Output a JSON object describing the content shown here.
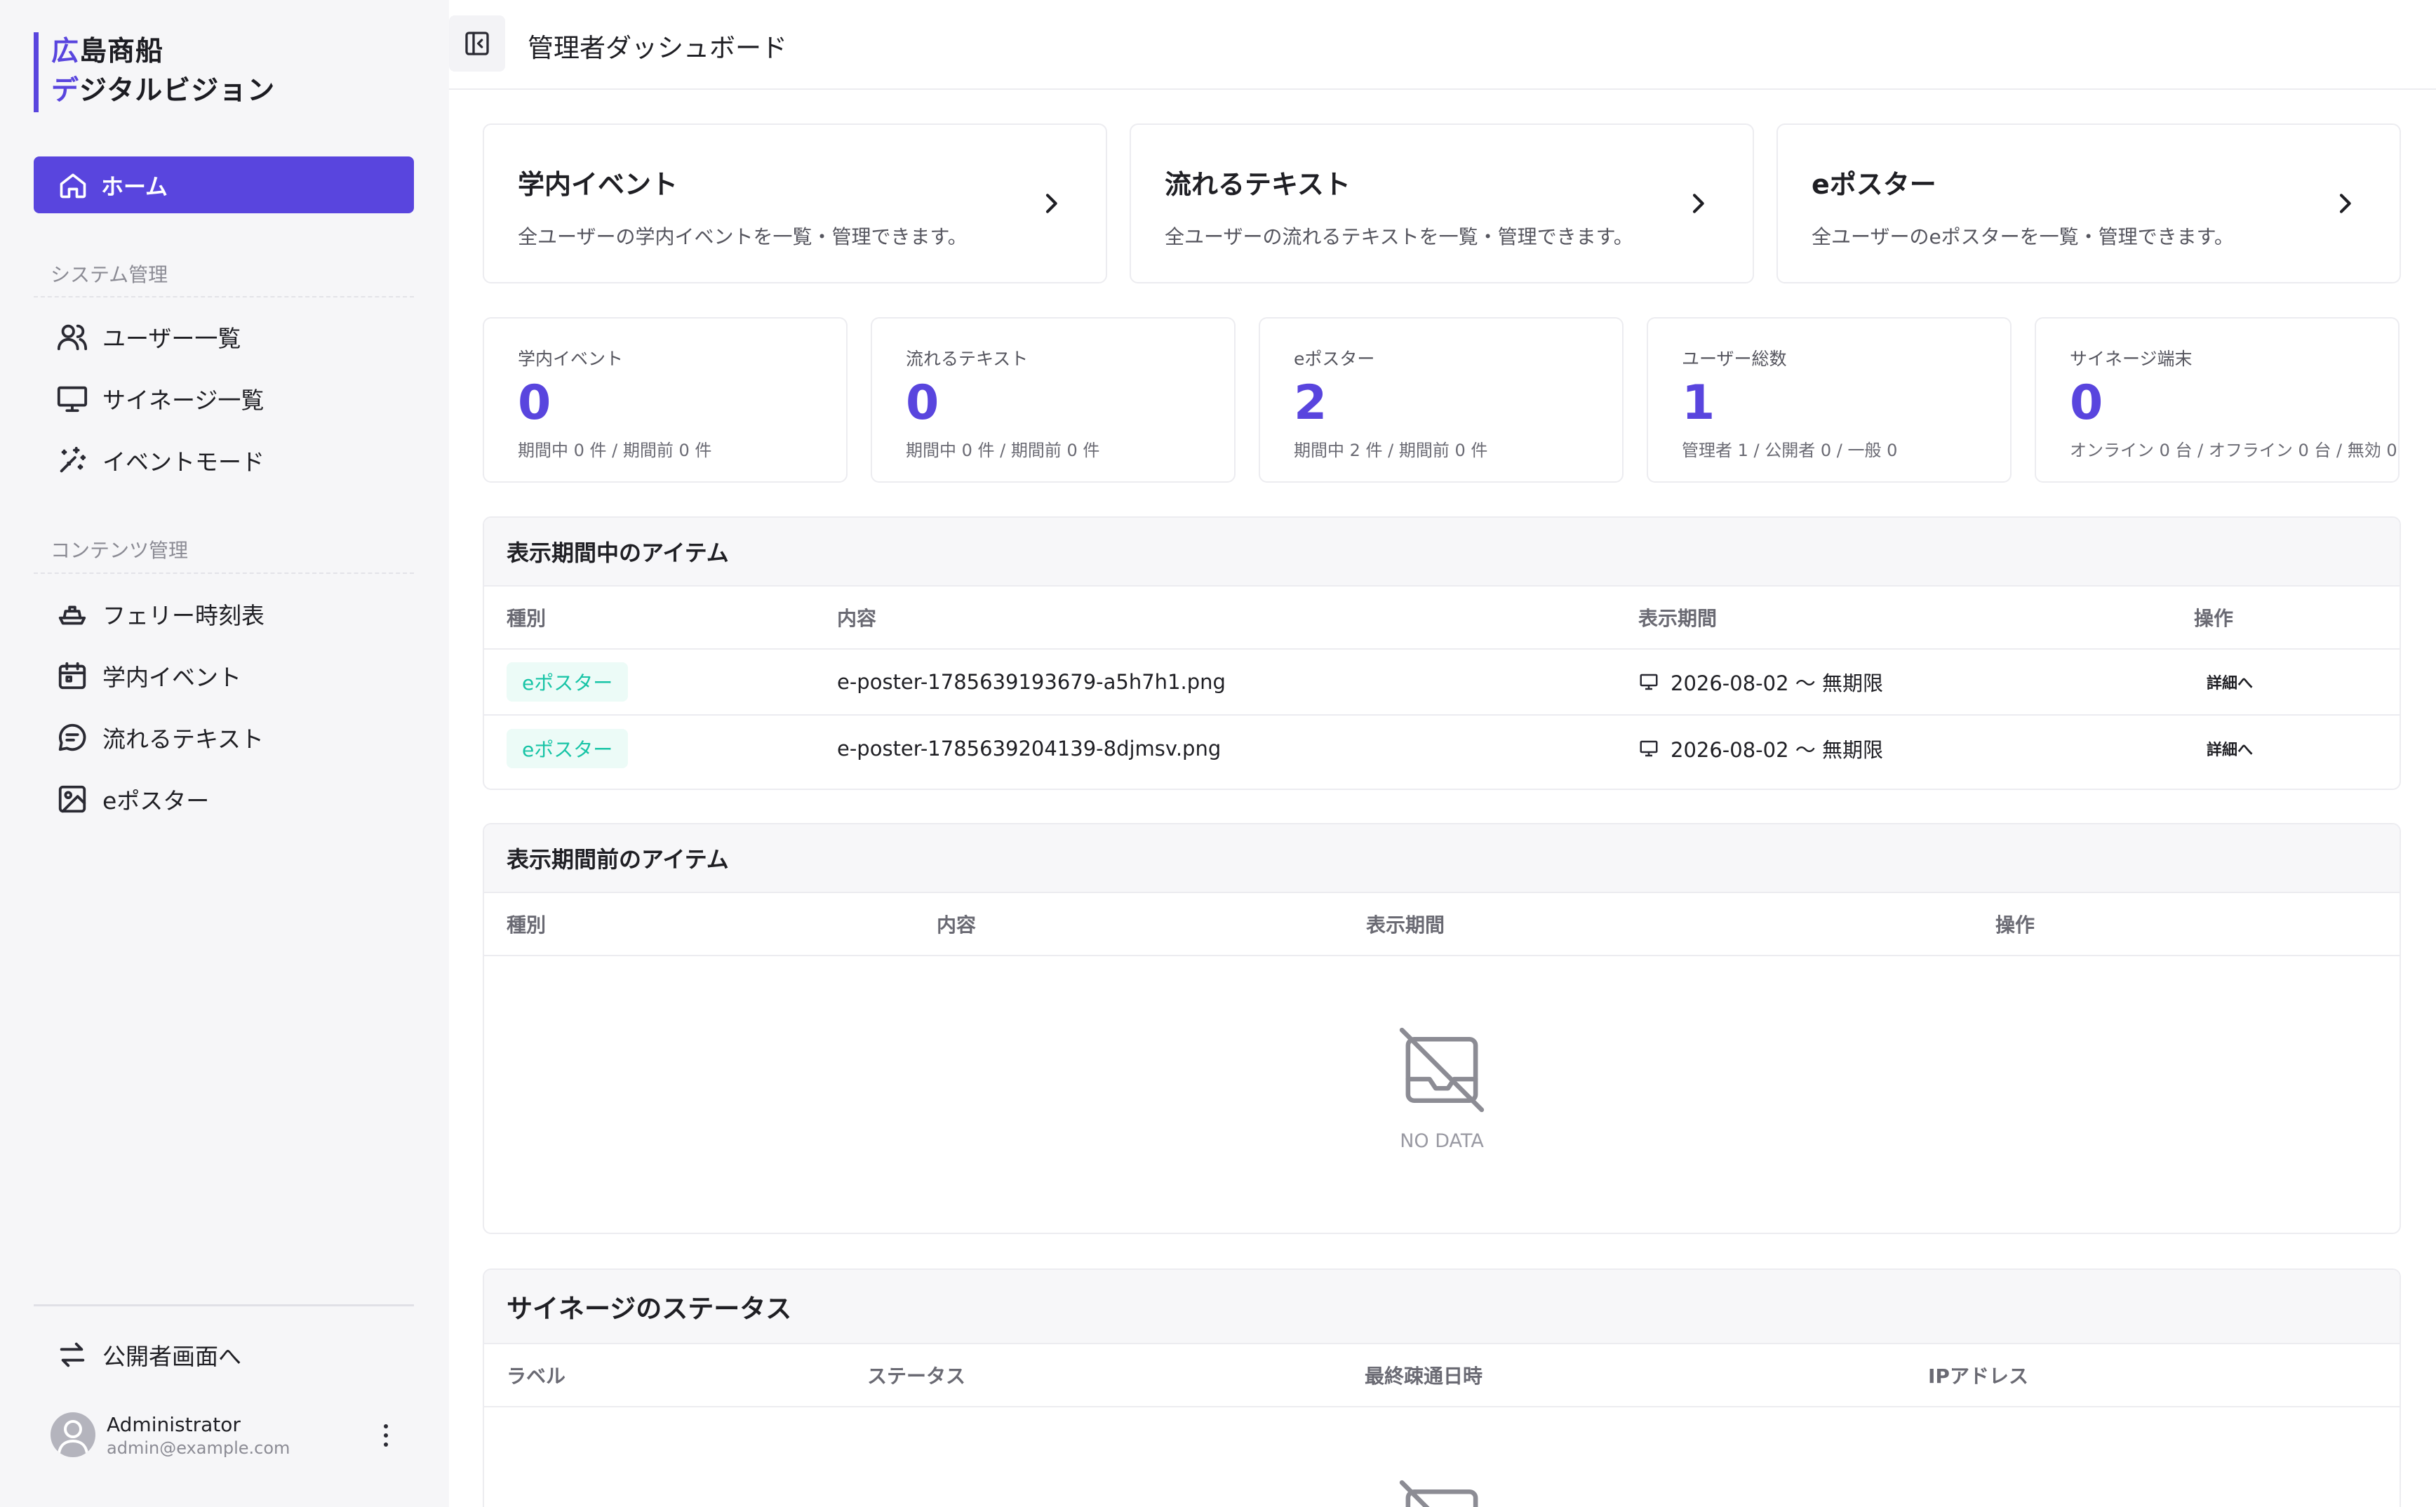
{
  "brand": {
    "line1_accent": "広",
    "line1_rest": "島商船",
    "line2_accent": "デ",
    "line2_rest": "ジタルビジョン"
  },
  "sidebar": {
    "home": "ホーム",
    "section_system": "システム管理",
    "system_items": [
      {
        "label": "ユーザー一覧",
        "icon": "users-icon"
      },
      {
        "label": "サイネージ一覧",
        "icon": "monitor-icon"
      },
      {
        "label": "イベントモード",
        "icon": "sparkles-icon"
      }
    ],
    "section_content": "コンテンツ管理",
    "content_items": [
      {
        "label": "フェリー時刻表",
        "icon": "ship-icon"
      },
      {
        "label": "学内イベント",
        "icon": "calendar-icon"
      },
      {
        "label": "流れるテキスト",
        "icon": "message-icon"
      },
      {
        "label": "eポスター",
        "icon": "image-icon"
      }
    ],
    "public_link": "公開者画面へ",
    "user": {
      "name": "Administrator",
      "email": "admin@example.com"
    }
  },
  "header": {
    "title": "管理者ダッシュボード"
  },
  "nav_cards": [
    {
      "title": "学内イベント",
      "desc": "全ユーザーの学内イベントを一覧・管理できます。"
    },
    {
      "title": "流れるテキスト",
      "desc": "全ユーザーの流れるテキストを一覧・管理できます。"
    },
    {
      "title": "eポスター",
      "desc": "全ユーザーのeポスターを一覧・管理できます。"
    }
  ],
  "stats": [
    {
      "label": "学内イベント",
      "value": "0",
      "sub": "期間中 0 件 / 期間前 0 件"
    },
    {
      "label": "流れるテキスト",
      "value": "0",
      "sub": "期間中 0 件 / 期間前 0 件"
    },
    {
      "label": "eポスター",
      "value": "2",
      "sub": "期間中 2 件 / 期間前 0 件"
    },
    {
      "label": "ユーザー総数",
      "value": "1",
      "sub": "管理者 1 / 公開者 0 / 一般 0"
    },
    {
      "label": "サイネージ端末",
      "value": "0",
      "sub": "オンライン 0 台 / オフライン 0 台 / 無効 0 台"
    }
  ],
  "active_panel": {
    "title": "表示期間中のアイテム",
    "columns": [
      "種別",
      "内容",
      "表示期間",
      "操作"
    ],
    "rows": [
      {
        "type": "eポスター",
        "content": "e-poster-1785639193679-a5h7h1.png",
        "period": "2026-08-02 〜 無期限",
        "action": "詳細へ"
      },
      {
        "type": "eポスター",
        "content": "e-poster-1785639204139-8djmsv.png",
        "period": "2026-08-02 〜 無期限",
        "action": "詳細へ"
      }
    ]
  },
  "upcoming_panel": {
    "title": "表示期間前のアイテム",
    "columns": [
      "種別",
      "内容",
      "表示期間",
      "操作"
    ],
    "empty": "NO DATA"
  },
  "signage_panel": {
    "title": "サイネージのステータス",
    "columns": [
      "ラベル",
      "ステータス",
      "最終疎通日時",
      "IPアドレス"
    ]
  },
  "colors": {
    "accent": "#5945de",
    "tag_text": "#17c4a6",
    "tag_bg": "#ecfbf7"
  }
}
